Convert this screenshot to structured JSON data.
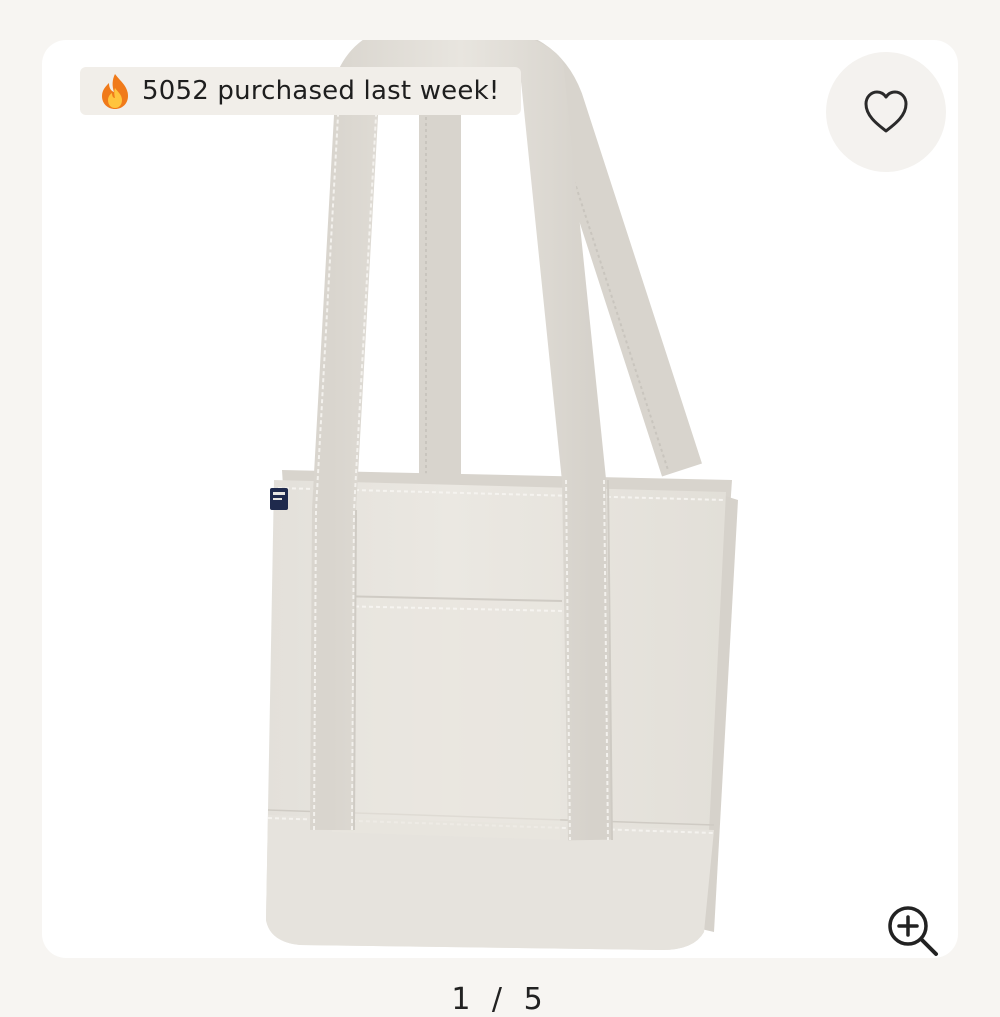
{
  "badge": {
    "icon": "fire-icon",
    "text": "5052 purchased last week!"
  },
  "favorite": {
    "icon": "heart-icon"
  },
  "zoom": {
    "icon": "zoom-in-icon"
  },
  "product": {
    "color": "#e9e6e0",
    "tag_color": "#1f2a4d"
  },
  "pager": {
    "text": "1 / 5"
  }
}
